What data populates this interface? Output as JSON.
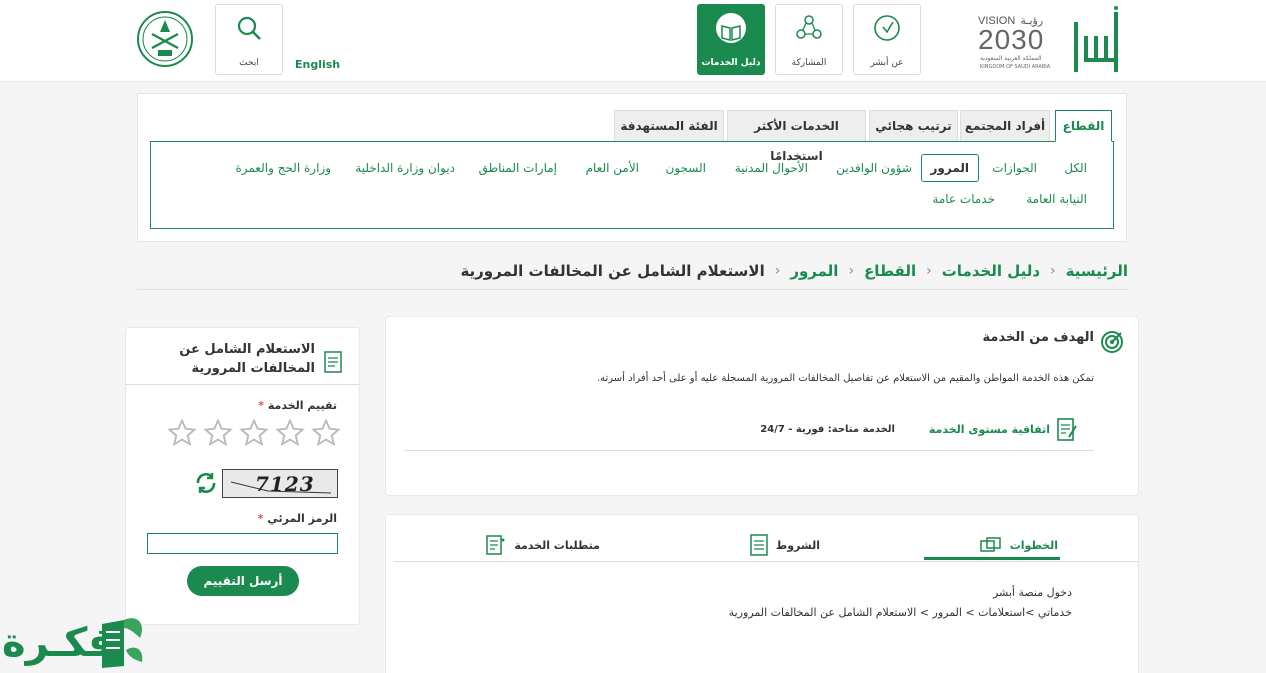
{
  "header": {
    "nav": [
      {
        "label": "عن أبشر",
        "icon": "info-icon"
      },
      {
        "label": "المشاركة",
        "icon": "share-icon"
      },
      {
        "label": "دليل الخدمات",
        "icon": "book-icon",
        "active": true
      }
    ],
    "english_label": "English",
    "search_label": "ابحث",
    "vision_text": "VISION",
    "vision_arabic": "رؤيـة",
    "vision_year": "2030",
    "vision_sub_ar": "المملكة العربية السعودية",
    "vision_sub_en": "KINGDOM OF SAUDI ARABIA",
    "absher_logo": "أبشر"
  },
  "filter": {
    "tabs": [
      "القطاع",
      "أفراد المجتمع",
      "ترتيب هجائي",
      "الخدمات الأكثر استخدامًا",
      "الفئة المستهدفة"
    ],
    "categories_row1": [
      "الكل",
      "الجوازات",
      "المرور",
      "شؤون الوافدين",
      "الأحوال المدنية",
      "السجون",
      "الأمن العام",
      "إمارات المناطق",
      "ديوان وزارة الداخلية",
      "وزارة الحج والعمرة"
    ],
    "categories_row2": [
      "النيابة العامة",
      "خدمات عامة"
    ]
  },
  "breadcrumb": {
    "items": [
      "الرئيسية",
      "دليل الخدمات",
      "القطاع",
      "المرور"
    ],
    "current": "الاستعلام الشامل عن المخالفات المرورية"
  },
  "goal": {
    "title": "الهدف من الخدمة",
    "description": "تمكن هذه الخدمة المواطن والمقيم من الاستعلام عن تفاصيل المخالفات المرورية المسجلة عليه أو على أحد أفراد أسرته.",
    "sla_label": "اتفاقية مستوى الخدمة",
    "availability": "الخدمة متاحة: فورية - 24/7"
  },
  "steps": {
    "tabs": [
      "الخطوات",
      "الشروط",
      "متطلبات الخدمة"
    ],
    "lines": [
      "دخول منصة أبشر",
      "خدماتي >استعلامات > المرور > الاستعلام الشامل عن المخالفات المرورية"
    ]
  },
  "rating": {
    "title": "الاستعلام الشامل عن المخالفات المرورية",
    "rating_label": "تقييم الخدمة",
    "required_mark": "*",
    "captcha_text": "7123",
    "code_label": "الرمز المرئي",
    "code_value": "",
    "submit_label": "أرسل التقييم",
    "stars_filled": 0,
    "stars_total": 5
  },
  "watermark": {
    "text": "فكـرة"
  },
  "colors": {
    "accent": "#1a8a4e",
    "border": "#e8e8e8"
  }
}
